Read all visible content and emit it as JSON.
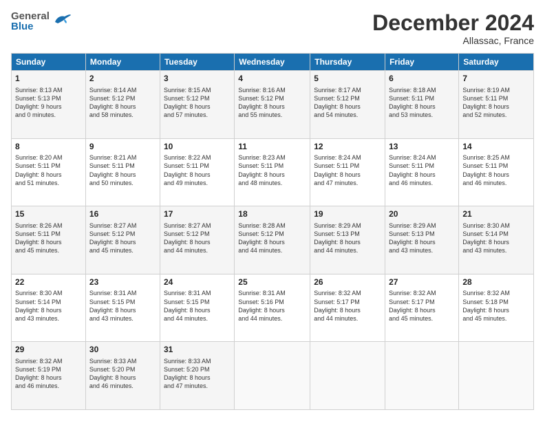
{
  "header": {
    "logo_general": "General",
    "logo_blue": "Blue",
    "month_title": "December 2024",
    "location": "Allassac, France"
  },
  "columns": [
    "Sunday",
    "Monday",
    "Tuesday",
    "Wednesday",
    "Thursday",
    "Friday",
    "Saturday"
  ],
  "weeks": [
    [
      {
        "day": "1",
        "lines": [
          "Sunrise: 8:13 AM",
          "Sunset: 5:13 PM",
          "Daylight: 9 hours",
          "and 0 minutes."
        ]
      },
      {
        "day": "2",
        "lines": [
          "Sunrise: 8:14 AM",
          "Sunset: 5:12 PM",
          "Daylight: 8 hours",
          "and 58 minutes."
        ]
      },
      {
        "day": "3",
        "lines": [
          "Sunrise: 8:15 AM",
          "Sunset: 5:12 PM",
          "Daylight: 8 hours",
          "and 57 minutes."
        ]
      },
      {
        "day": "4",
        "lines": [
          "Sunrise: 8:16 AM",
          "Sunset: 5:12 PM",
          "Daylight: 8 hours",
          "and 55 minutes."
        ]
      },
      {
        "day": "5",
        "lines": [
          "Sunrise: 8:17 AM",
          "Sunset: 5:12 PM",
          "Daylight: 8 hours",
          "and 54 minutes."
        ]
      },
      {
        "day": "6",
        "lines": [
          "Sunrise: 8:18 AM",
          "Sunset: 5:11 PM",
          "Daylight: 8 hours",
          "and 53 minutes."
        ]
      },
      {
        "day": "7",
        "lines": [
          "Sunrise: 8:19 AM",
          "Sunset: 5:11 PM",
          "Daylight: 8 hours",
          "and 52 minutes."
        ]
      }
    ],
    [
      {
        "day": "8",
        "lines": [
          "Sunrise: 8:20 AM",
          "Sunset: 5:11 PM",
          "Daylight: 8 hours",
          "and 51 minutes."
        ]
      },
      {
        "day": "9",
        "lines": [
          "Sunrise: 8:21 AM",
          "Sunset: 5:11 PM",
          "Daylight: 8 hours",
          "and 50 minutes."
        ]
      },
      {
        "day": "10",
        "lines": [
          "Sunrise: 8:22 AM",
          "Sunset: 5:11 PM",
          "Daylight: 8 hours",
          "and 49 minutes."
        ]
      },
      {
        "day": "11",
        "lines": [
          "Sunrise: 8:23 AM",
          "Sunset: 5:11 PM",
          "Daylight: 8 hours",
          "and 48 minutes."
        ]
      },
      {
        "day": "12",
        "lines": [
          "Sunrise: 8:24 AM",
          "Sunset: 5:11 PM",
          "Daylight: 8 hours",
          "and 47 minutes."
        ]
      },
      {
        "day": "13",
        "lines": [
          "Sunrise: 8:24 AM",
          "Sunset: 5:11 PM",
          "Daylight: 8 hours",
          "and 46 minutes."
        ]
      },
      {
        "day": "14",
        "lines": [
          "Sunrise: 8:25 AM",
          "Sunset: 5:11 PM",
          "Daylight: 8 hours",
          "and 46 minutes."
        ]
      }
    ],
    [
      {
        "day": "15",
        "lines": [
          "Sunrise: 8:26 AM",
          "Sunset: 5:11 PM",
          "Daylight: 8 hours",
          "and 45 minutes."
        ]
      },
      {
        "day": "16",
        "lines": [
          "Sunrise: 8:27 AM",
          "Sunset: 5:12 PM",
          "Daylight: 8 hours",
          "and 45 minutes."
        ]
      },
      {
        "day": "17",
        "lines": [
          "Sunrise: 8:27 AM",
          "Sunset: 5:12 PM",
          "Daylight: 8 hours",
          "and 44 minutes."
        ]
      },
      {
        "day": "18",
        "lines": [
          "Sunrise: 8:28 AM",
          "Sunset: 5:12 PM",
          "Daylight: 8 hours",
          "and 44 minutes."
        ]
      },
      {
        "day": "19",
        "lines": [
          "Sunrise: 8:29 AM",
          "Sunset: 5:13 PM",
          "Daylight: 8 hours",
          "and 44 minutes."
        ]
      },
      {
        "day": "20",
        "lines": [
          "Sunrise: 8:29 AM",
          "Sunset: 5:13 PM",
          "Daylight: 8 hours",
          "and 43 minutes."
        ]
      },
      {
        "day": "21",
        "lines": [
          "Sunrise: 8:30 AM",
          "Sunset: 5:14 PM",
          "Daylight: 8 hours",
          "and 43 minutes."
        ]
      }
    ],
    [
      {
        "day": "22",
        "lines": [
          "Sunrise: 8:30 AM",
          "Sunset: 5:14 PM",
          "Daylight: 8 hours",
          "and 43 minutes."
        ]
      },
      {
        "day": "23",
        "lines": [
          "Sunrise: 8:31 AM",
          "Sunset: 5:15 PM",
          "Daylight: 8 hours",
          "and 43 minutes."
        ]
      },
      {
        "day": "24",
        "lines": [
          "Sunrise: 8:31 AM",
          "Sunset: 5:15 PM",
          "Daylight: 8 hours",
          "and 44 minutes."
        ]
      },
      {
        "day": "25",
        "lines": [
          "Sunrise: 8:31 AM",
          "Sunset: 5:16 PM",
          "Daylight: 8 hours",
          "and 44 minutes."
        ]
      },
      {
        "day": "26",
        "lines": [
          "Sunrise: 8:32 AM",
          "Sunset: 5:17 PM",
          "Daylight: 8 hours",
          "and 44 minutes."
        ]
      },
      {
        "day": "27",
        "lines": [
          "Sunrise: 8:32 AM",
          "Sunset: 5:17 PM",
          "Daylight: 8 hours",
          "and 45 minutes."
        ]
      },
      {
        "day": "28",
        "lines": [
          "Sunrise: 8:32 AM",
          "Sunset: 5:18 PM",
          "Daylight: 8 hours",
          "and 45 minutes."
        ]
      }
    ],
    [
      {
        "day": "29",
        "lines": [
          "Sunrise: 8:32 AM",
          "Sunset: 5:19 PM",
          "Daylight: 8 hours",
          "and 46 minutes."
        ]
      },
      {
        "day": "30",
        "lines": [
          "Sunrise: 8:33 AM",
          "Sunset: 5:20 PM",
          "Daylight: 8 hours",
          "and 46 minutes."
        ]
      },
      {
        "day": "31",
        "lines": [
          "Sunrise: 8:33 AM",
          "Sunset: 5:20 PM",
          "Daylight: 8 hours",
          "and 47 minutes."
        ]
      },
      null,
      null,
      null,
      null
    ]
  ]
}
